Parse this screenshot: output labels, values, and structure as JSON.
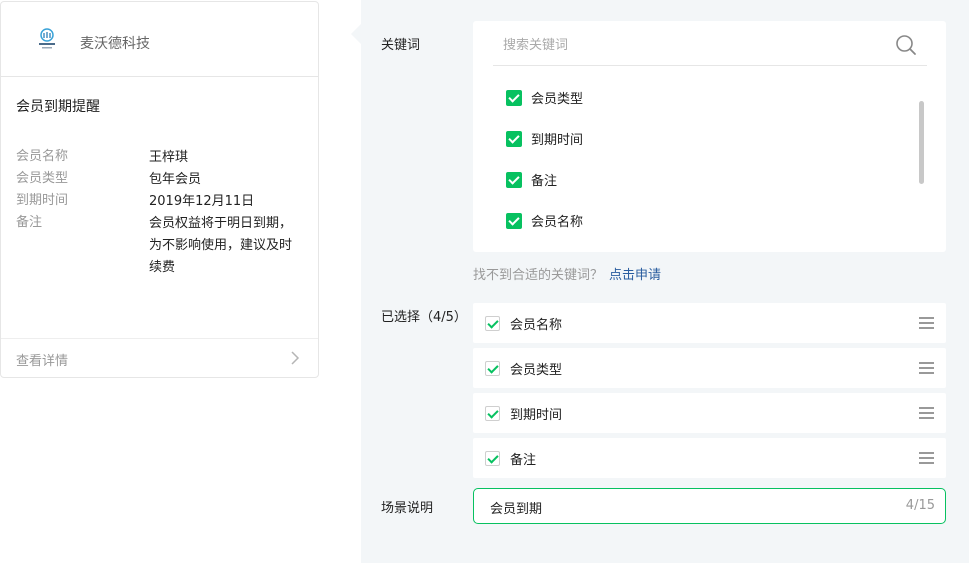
{
  "card": {
    "company": "麦沃德科技",
    "title": "会员到期提醒",
    "fields": [
      {
        "label": "会员名称",
        "value": "王梓琪"
      },
      {
        "label": "会员类型",
        "value": "包年会员"
      },
      {
        "label": "到期时间",
        "value": "2019年12月11日"
      },
      {
        "label": "备注",
        "value": "会员权益将于明日到期，为不影响使用，建议及时续费"
      }
    ],
    "footer": "查看详情"
  },
  "panel": {
    "keywords_label": "关键词",
    "search_placeholder": "搜索关键词",
    "keywords": [
      "会员类型",
      "到期时间",
      "备注",
      "会员名称"
    ],
    "hint_text": "找不到合适的关键词？",
    "hint_link": "点击申请",
    "selected_label": "已选择（4/5）",
    "selected": [
      "会员名称",
      "会员类型",
      "到期时间",
      "备注"
    ],
    "scene_label": "场景说明",
    "scene_value": "会员到期",
    "scene_counter": "4/15"
  },
  "colors": {
    "accent": "#07c160",
    "link": "#2a5d9f",
    "panel_bg": "#f3f6f8"
  }
}
